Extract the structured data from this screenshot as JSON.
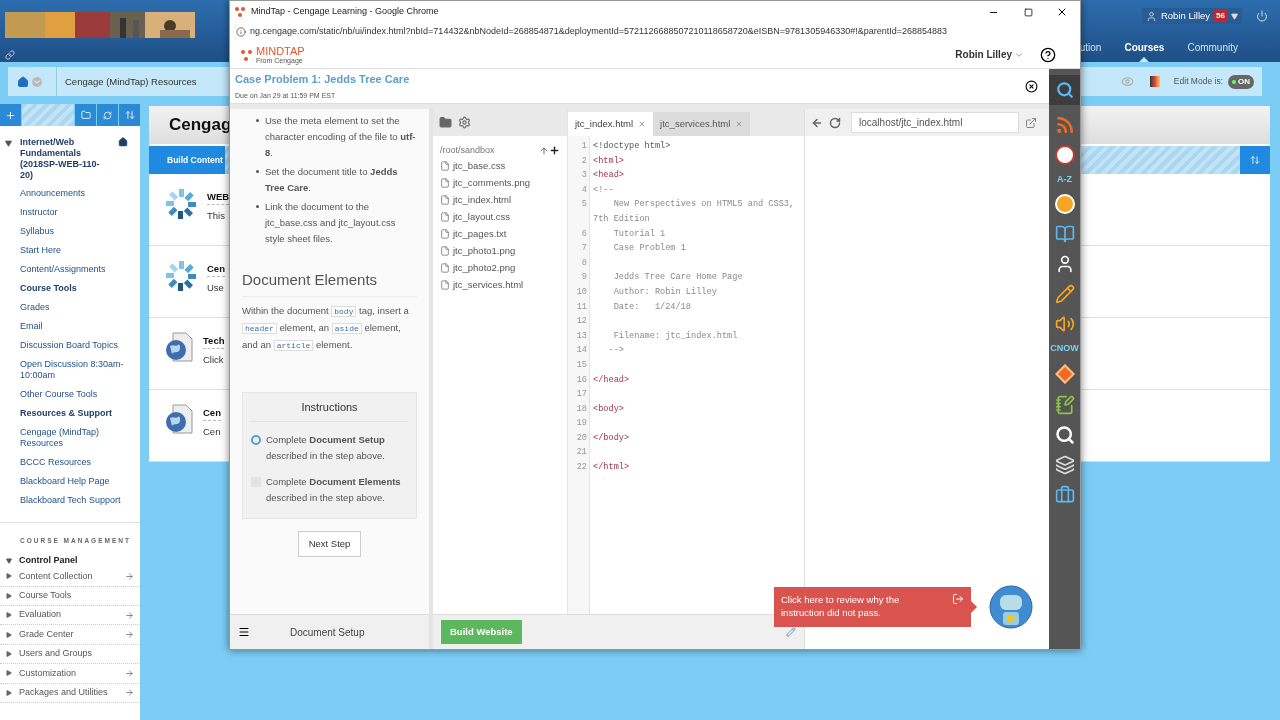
{
  "portal": {
    "nav": [
      {
        "label": "ution",
        "selected": false
      },
      {
        "label": "Courses",
        "selected": true
      },
      {
        "label": "Community",
        "selected": false
      }
    ],
    "user": {
      "name": "Robin Lilley",
      "badge": "56"
    },
    "breadcrumb": "Cengage (MindTap) Resources",
    "edit_mode": {
      "label": "Edit Mode is:",
      "value": "ON",
      "on": true
    },
    "course": {
      "title": "Internet/Web Fundamentals (2018SP-WEB-110-20)",
      "expanded": true,
      "items": [
        {
          "label": "Announcements",
          "kind": "link"
        },
        {
          "label": "Instructor",
          "kind": "link"
        },
        {
          "label": "Syllabus",
          "kind": "link"
        },
        {
          "label": "Start Here",
          "kind": "link"
        },
        {
          "label": "Content/Assignments",
          "kind": "link"
        },
        {
          "label": "Course Tools",
          "kind": "heading"
        },
        {
          "label": "Grades",
          "kind": "link"
        },
        {
          "label": "Email",
          "kind": "link"
        },
        {
          "label": "Discussion Board Topics",
          "kind": "link"
        },
        {
          "label": "Open Discussion 8:30am-10:00am",
          "kind": "link"
        },
        {
          "label": "Other Course Tools",
          "kind": "link"
        },
        {
          "label": "Resources & Support",
          "kind": "heading"
        },
        {
          "label": "Cengage (MindTap) Resources",
          "kind": "link"
        },
        {
          "label": "BCCC Resources",
          "kind": "link"
        },
        {
          "label": "Blackboard Help Page",
          "kind": "link"
        },
        {
          "label": "Blackboard Tech Support",
          "kind": "link"
        }
      ]
    },
    "management": {
      "heading": "COURSE MANAGEMENT",
      "panel": {
        "label": "Control Panel",
        "expanded": true
      },
      "items": [
        {
          "label": "Content Collection",
          "arrow": true
        },
        {
          "label": "Course Tools",
          "arrow": false
        },
        {
          "label": "Evaluation",
          "arrow": true
        },
        {
          "label": "Grade Center",
          "arrow": true
        },
        {
          "label": "Users and Groups",
          "arrow": false
        },
        {
          "label": "Customization",
          "arrow": true
        },
        {
          "label": "Packages and Utilities",
          "arrow": true
        }
      ]
    },
    "content": {
      "title": "Cengag",
      "build_button": "Build Content",
      "items": [
        {
          "kind": "spinner",
          "title": "WEB",
          "text": "This"
        },
        {
          "kind": "spinner",
          "title": "Cen",
          "text": "Use"
        },
        {
          "kind": "document",
          "title": "Tech",
          "text": "Click"
        },
        {
          "kind": "document",
          "title": "Cen",
          "text": "Cen"
        }
      ]
    }
  },
  "browser": {
    "title": "MindTap - Cengage Learning - Google Chrome",
    "url": "ng.cengage.com/static/nb/ui/index.html?nbId=714432&nbNodeId=268854871&deploymentId=5721126688507210118658720&eISBN=9781305946330#!&parentId=268854883"
  },
  "mindtap": {
    "logo": "MINDTAP",
    "logo_sub": "From Cengage",
    "user": "Robin Lilley",
    "activity": {
      "title": "Case Problem 1: Jedds Tree Care",
      "due": "Due on Jan 29 at 11:59 PM EST"
    },
    "steps": [
      "Use the meta element to set the character encoding of the file to **utf-8**.",
      "Set the document title to **Jedds Tree Care**.",
      "Link the document to the jtc_base.css and jtc_layout.css style sheet files."
    ],
    "section": {
      "heading": "Document Elements",
      "body": [
        {
          "kind": "text",
          "text": "Within the document "
        },
        {
          "kind": "code",
          "text": "body"
        },
        {
          "kind": "text",
          "text": " tag, insert a "
        },
        {
          "kind": "code",
          "text": "header"
        },
        {
          "kind": "text",
          "text": " element, an "
        },
        {
          "kind": "code",
          "text": "aside"
        },
        {
          "kind": "text",
          "text": " element, and an "
        },
        {
          "kind": "code",
          "text": "article"
        },
        {
          "kind": "text",
          "text": " element."
        }
      ]
    },
    "instructions": {
      "heading": "Instructions",
      "items": [
        {
          "text": "Complete **Document Setup** described in the step above.",
          "kind": "ring"
        },
        {
          "text": "Complete **Document Elements** described in the step above.",
          "kind": "checkbox",
          "checked": false
        }
      ]
    },
    "next_button": "Next Step",
    "current_step": "Document Setup",
    "files": {
      "path": "/root/sandbox",
      "items": [
        "jtc_base.css",
        "jtc_comments.png",
        "jtc_index.html",
        "jtc_layout.css",
        "jtc_pages.txt",
        "jtc_photo1.png",
        "jtc_photo2.png",
        "jtc_services.html"
      ]
    },
    "tabs": [
      {
        "label": "jtc_index.html",
        "selected": true
      },
      {
        "label": "jtc_services.html",
        "selected": false
      }
    ],
    "code": [
      {
        "n": "1",
        "kind": "doctype",
        "text": "<!doctype html>"
      },
      {
        "n": "2",
        "kind": "tag",
        "text": "<html>"
      },
      {
        "n": "3",
        "kind": "tag",
        "text": "<head>"
      },
      {
        "n": "4",
        "kind": "comment",
        "text": "<!--"
      },
      {
        "n": "5",
        "kind": "comment",
        "text": "    New Perspectives on HTML5 and CSS3, 7th Edition"
      },
      {
        "n": "6",
        "kind": "comment",
        "text": "    Tutorial 1"
      },
      {
        "n": "7",
        "kind": "comment",
        "text": "    Case Problem 1"
      },
      {
        "n": "8"
      },
      {
        "n": "9",
        "kind": "comment",
        "text": "    Jedds Tree Care Home Page"
      },
      {
        "n": "10",
        "kind": "comment",
        "text": "    Author: Robin Lilley"
      },
      {
        "n": "11",
        "kind": "comment",
        "text": "    Date:   1/24/18"
      },
      {
        "n": "12"
      },
      {
        "n": "13",
        "kind": "comment",
        "text": "    Filename: jtc_index.html"
      },
      {
        "n": "14",
        "kind": "comment",
        "text": "   -->"
      },
      {
        "n": "15"
      },
      {
        "n": "16",
        "kind": "tag",
        "text": "</head>"
      },
      {
        "n": "17"
      },
      {
        "n": "18",
        "kind": "tag",
        "text": "<body>"
      },
      {
        "n": "19"
      },
      {
        "n": "20",
        "kind": "tag",
        "text": "</body>"
      },
      {
        "n": "21"
      },
      {
        "n": "22",
        "kind": "tag",
        "text": "</html>"
      }
    ],
    "build_button": "Build Website",
    "preview_url": "localhost/jtc_index.html",
    "alert": "Click here to review why the instruction did not pass.",
    "tools": [
      {
        "kind": "search"
      },
      {
        "kind": "rss"
      },
      {
        "kind": "seal"
      },
      {
        "kind": "text",
        "label": "A-Z"
      },
      {
        "kind": "coin"
      },
      {
        "kind": "book"
      },
      {
        "kind": "person"
      },
      {
        "kind": "pencil"
      },
      {
        "kind": "audio"
      },
      {
        "kind": "text",
        "label": "CNOW"
      },
      {
        "kind": "diamond"
      },
      {
        "kind": "notes"
      },
      {
        "kind": "quiz"
      },
      {
        "kind": "cards"
      },
      {
        "kind": "briefcase"
      }
    ]
  }
}
